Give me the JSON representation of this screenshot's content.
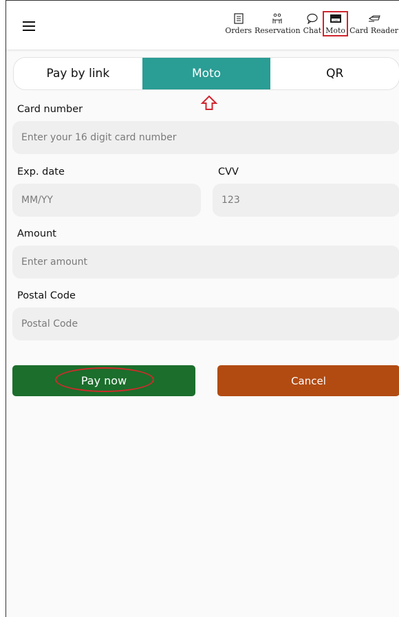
{
  "header": {
    "nav": [
      {
        "label": "Orders",
        "icon": "orders-icon"
      },
      {
        "label": "Reservation",
        "icon": "reservation-icon"
      },
      {
        "label": "Chat",
        "icon": "chat-icon"
      },
      {
        "label": "Moto",
        "icon": "cvv-card-icon"
      },
      {
        "label": "Card Reader",
        "icon": "card-reader-icon"
      }
    ]
  },
  "tabs": [
    {
      "label": "Pay by link",
      "active": false
    },
    {
      "label": "Moto",
      "active": true
    },
    {
      "label": "QR",
      "active": false
    }
  ],
  "form": {
    "card_number": {
      "label": "Card number",
      "placeholder": "Enter your 16 digit card number"
    },
    "exp_date": {
      "label": "Exp. date",
      "placeholder": "MM/YY"
    },
    "cvv": {
      "label": "CVV",
      "placeholder": "123"
    },
    "amount": {
      "label": "Amount",
      "placeholder": "Enter amount"
    },
    "postal_code": {
      "label": "Postal Code",
      "placeholder": "Postal Code"
    }
  },
  "actions": {
    "pay_label": "Pay now",
    "cancel_label": "Cancel"
  },
  "colors": {
    "accent_tab": "#2a9d94",
    "pay_button": "#1b6e2c",
    "cancel_button": "#b14b12",
    "annotation_red": "#d0242e"
  }
}
